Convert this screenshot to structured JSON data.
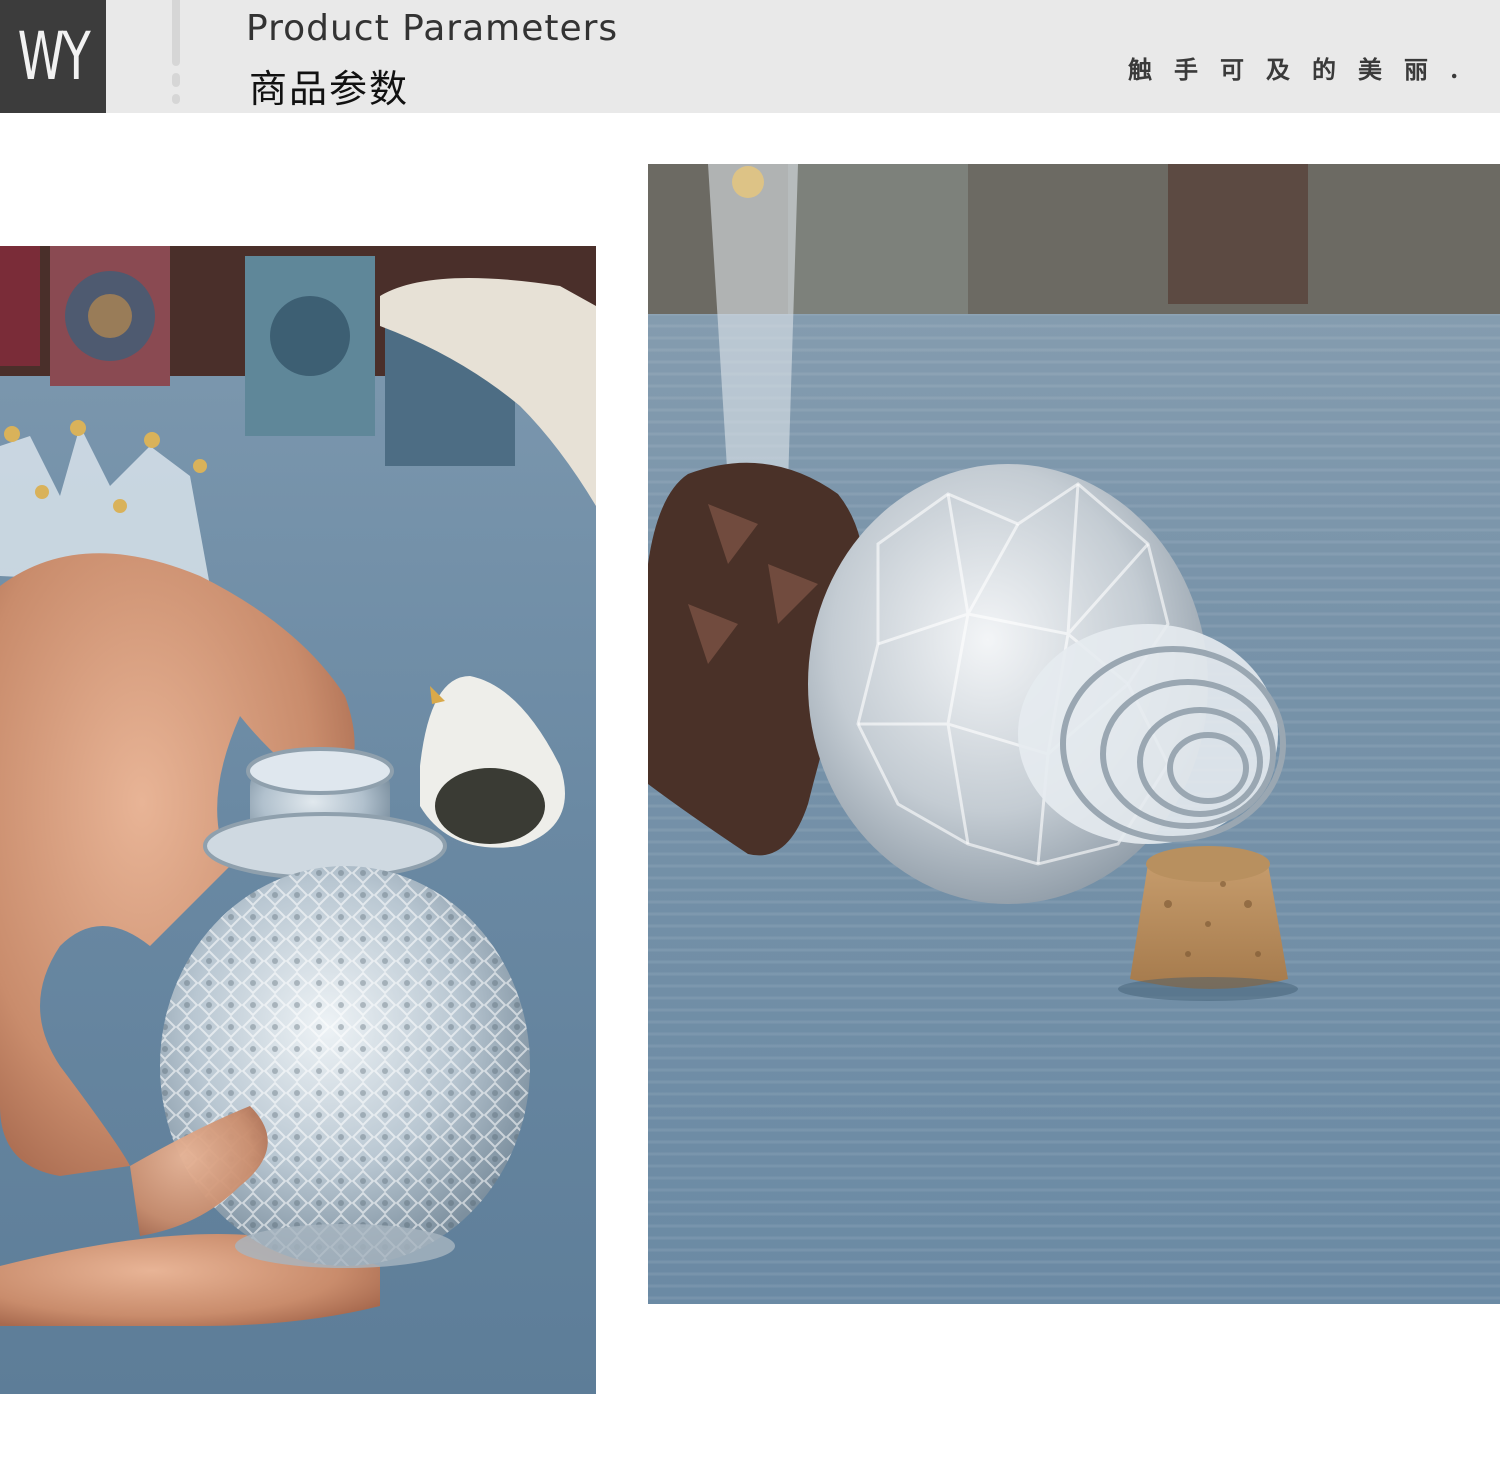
{
  "header": {
    "logo_text": "WY",
    "title_en": "Product Parameters",
    "title_cn": "商品参数",
    "slogan": "触手可及的美丽."
  },
  "photos": [
    {
      "subject": "hand-holding-round-textured-glass-bottle"
    },
    {
      "subject": "faceted-glass-bottle-lying-with-cork-stopper"
    }
  ],
  "colors": {
    "header_bg": "#e9e9e9",
    "logo_bg": "#3c3c3c",
    "cloth_blue": "#6f8ea6"
  }
}
